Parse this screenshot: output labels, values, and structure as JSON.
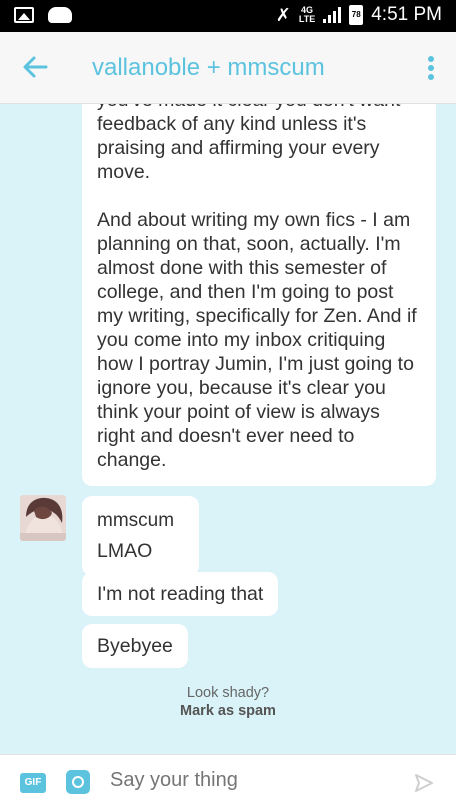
{
  "status_bar": {
    "time": "4:51 PM",
    "network": "4G",
    "network_sub": "LTE",
    "battery": "78"
  },
  "header": {
    "title": "vallanoble + mmscum"
  },
  "messages": {
    "long_message": {
      "lines_partial": "you've made it clear you don't want feedback of any kind unless it's praising and affirming your every move.",
      "paragraph_2": "And about writing my own fics - I am planning on that, soon, actually. I'm almost done with this semester of college, and then I'm going to post my writing, specifically for Zen. And if you come into my inbox critiquing how I portray Jumin, I'm just going to ignore you, because it's clear you think your point of view is always right and doesn't ever need to change."
    },
    "sender_name": "mmscum",
    "reply_1": "LMAO",
    "reply_2": "I'm not reading that",
    "reply_3": "Byebyee"
  },
  "spam": {
    "question": "Look shady?",
    "link": "Mark as spam"
  },
  "composer": {
    "gif_label": "GIF",
    "placeholder": "Say your thing"
  },
  "colors": {
    "accent": "#5cc3df",
    "background": "#d9f3f8"
  }
}
